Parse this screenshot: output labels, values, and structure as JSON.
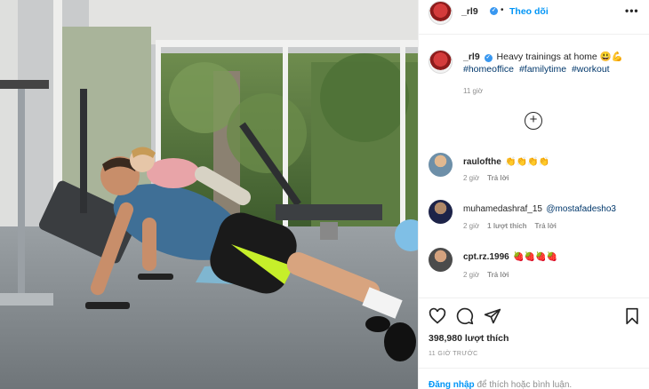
{
  "post": {
    "username": "_rl9",
    "dot": "•",
    "follow_label": "Theo dõi",
    "more_label": "•••",
    "caption": {
      "username": "_rl9",
      "text": "Heavy trainings at home 😃💪",
      "hashtags": [
        "#homeoffice",
        "#familytime",
        "#workout"
      ],
      "time": "11 giờ"
    },
    "load_more_label": "+",
    "comments": [
      {
        "username": "raulofthe",
        "text": "👏👏👏👏",
        "time": "2 giờ",
        "likes": "",
        "reply": "Trả lời"
      },
      {
        "username": "muhamedashraf_15",
        "text": "@mostafadesho3",
        "time": "2 giờ",
        "likes": "1 lượt thích",
        "reply": "Trả lời"
      },
      {
        "username": "cpt.rz.1996",
        "text": "🍓🍓🍓🍓",
        "time": "2 giờ",
        "likes": "",
        "reply": "Trả lời"
      }
    ],
    "likes_count": "398,980 lượt thích",
    "posted_ago": "11 GIỜ TRƯỚC",
    "login": {
      "link": "Đăng nhập",
      "suffix": " để thích hoặc bình luận."
    }
  },
  "icons": {
    "like": "heart-icon",
    "comment": "comment-icon",
    "share": "paper-plane-icon",
    "save": "bookmark-icon",
    "load_more": "plus-circle-icon",
    "verified": "verified-badge-icon"
  },
  "colors": {
    "accent": "#0095f6",
    "hashtag": "#00376b",
    "verified": "#3897f0",
    "muted": "#8e8e8e",
    "shorts_accent": "#c6ef2a",
    "shirt": "#3f6f96",
    "child_top": "#e8a4a8"
  }
}
